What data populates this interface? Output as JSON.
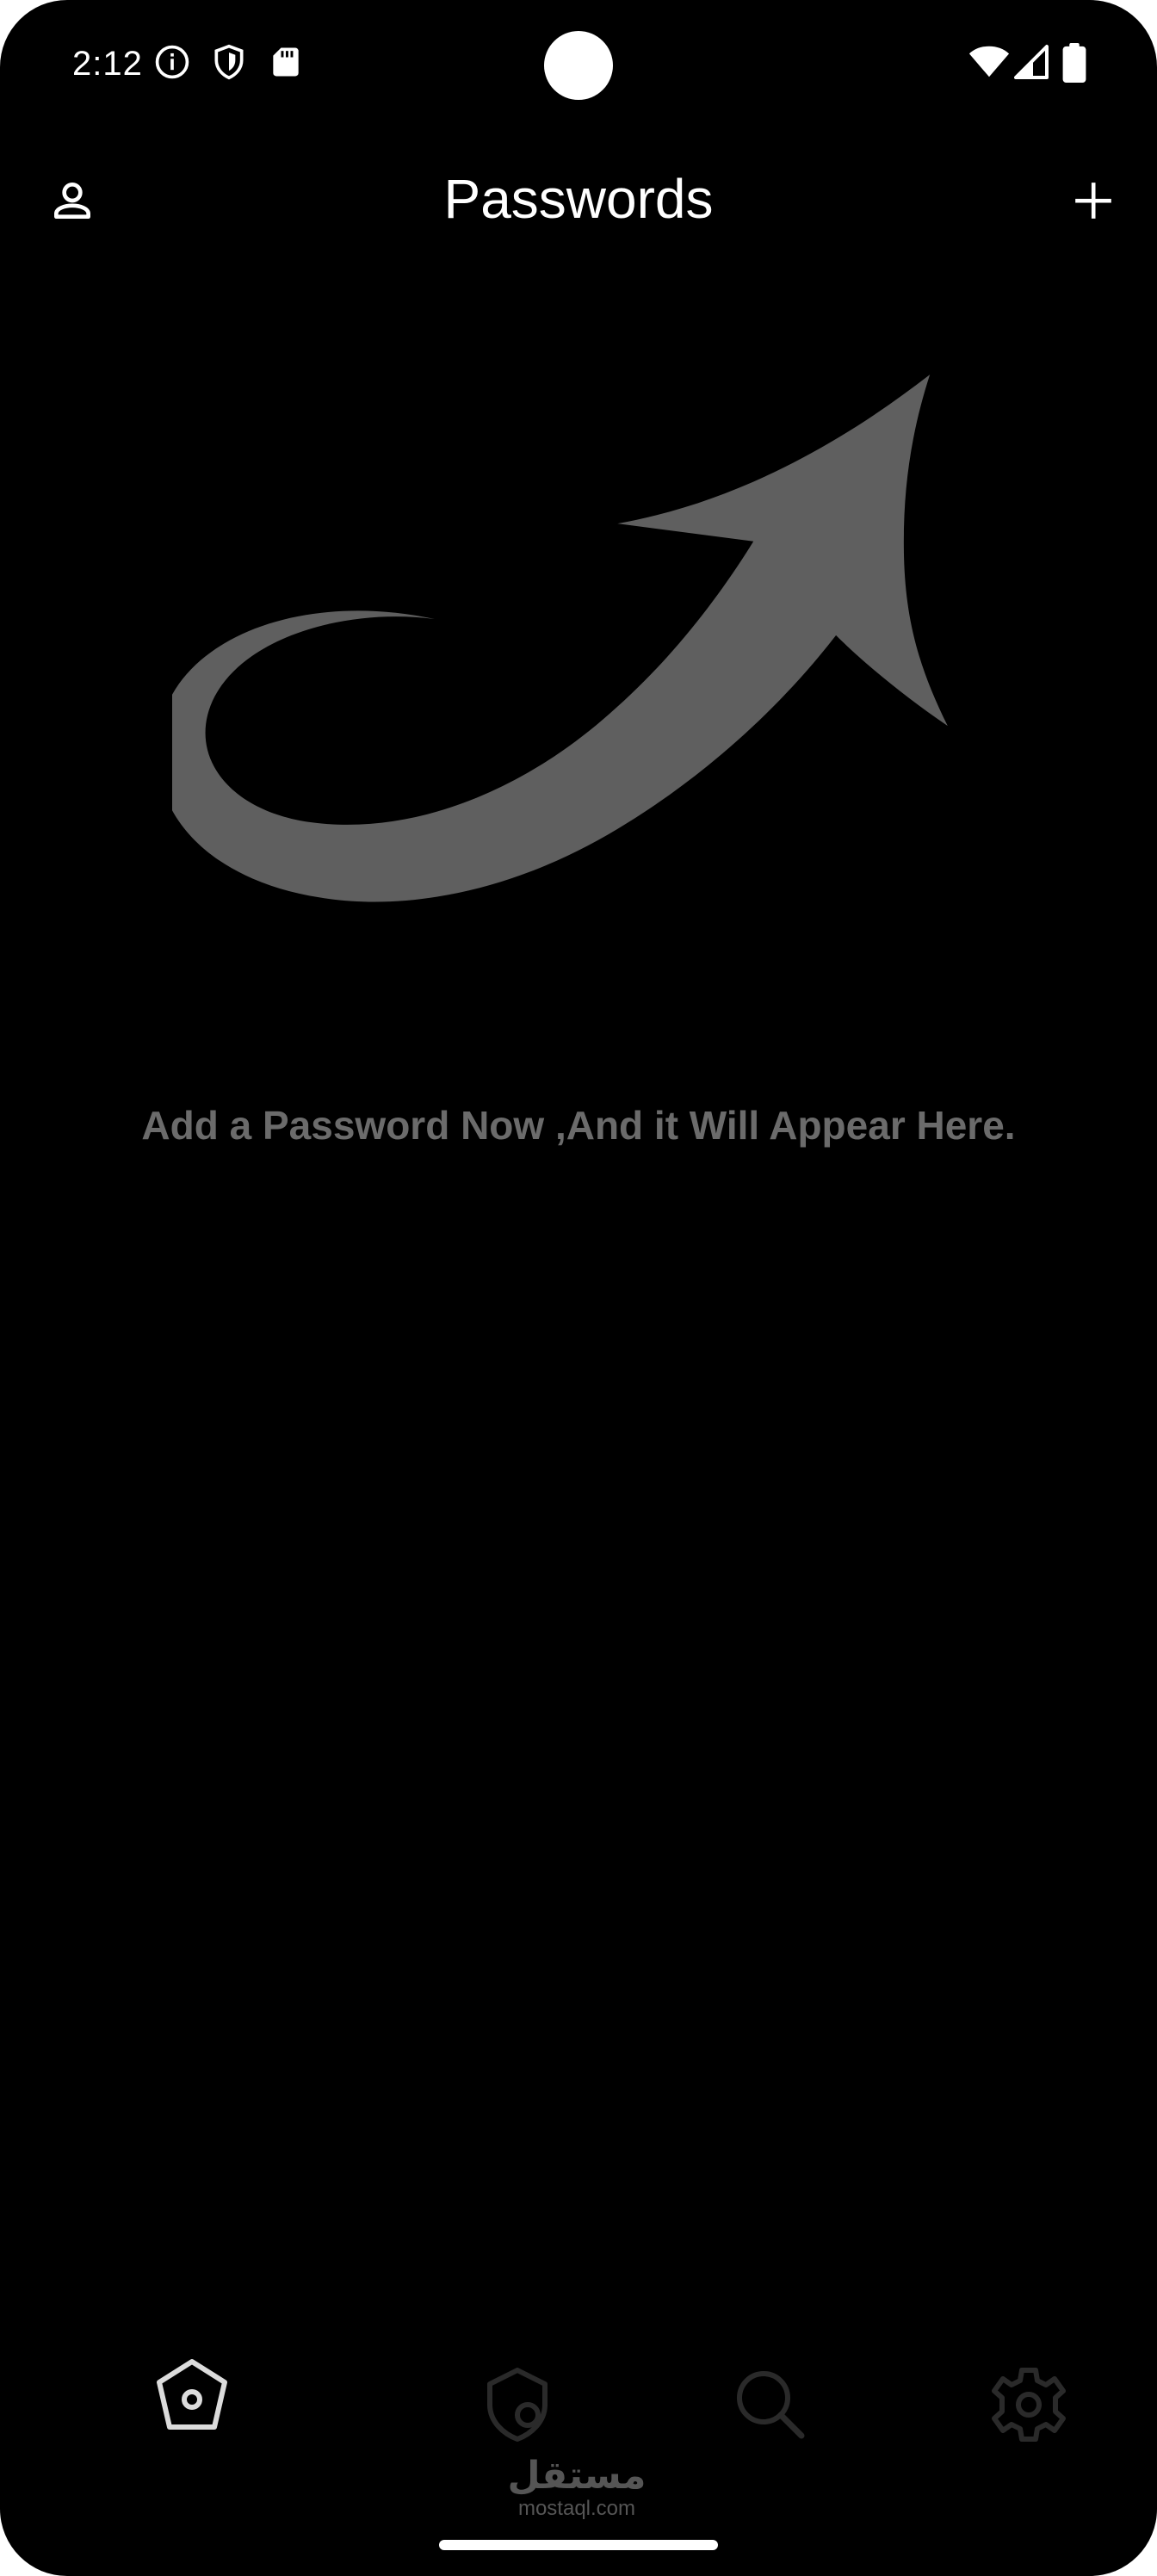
{
  "status_bar": {
    "time": "2:12",
    "icons": [
      "info-icon",
      "shield-icon",
      "sd-card-icon",
      "wifi-icon",
      "signal-icon",
      "battery-icon"
    ]
  },
  "app_bar": {
    "title": "Passwords",
    "left_icon": "account-icon",
    "right_icon": "add-icon"
  },
  "empty_state": {
    "illustration": "curved-arrow-illustration",
    "message": "Add a Password Now ,And it Will Appear Here."
  },
  "bottom_nav": {
    "items": [
      {
        "icon": "home-icon",
        "active": true
      },
      {
        "icon": "security-check-icon",
        "active": false
      },
      {
        "icon": "search-icon",
        "active": false
      },
      {
        "icon": "settings-icon",
        "active": false
      }
    ]
  },
  "watermark": {
    "arabic": "مستقل",
    "latin": "mostaql.com"
  },
  "colors": {
    "background": "#000000",
    "foreground": "#ffffff",
    "muted": "#6b6b6b",
    "illustration": "#5f5f5f"
  }
}
